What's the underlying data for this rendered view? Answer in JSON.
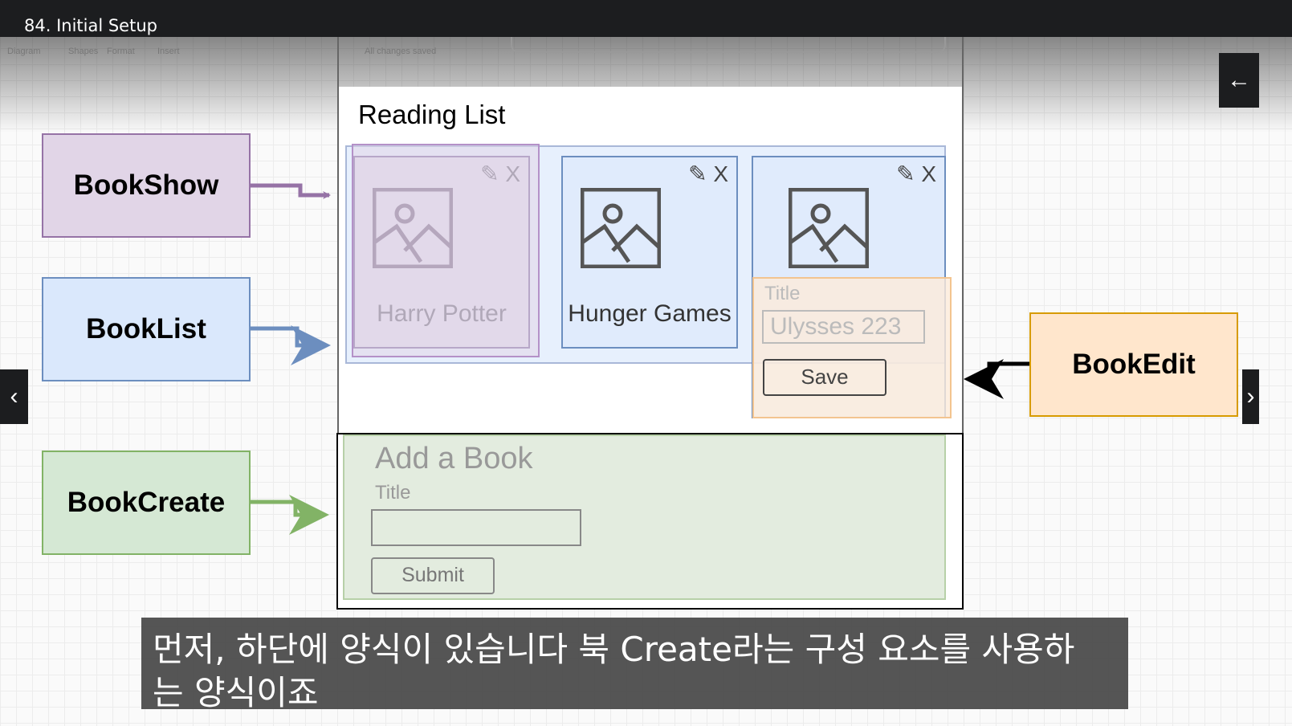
{
  "player": {
    "lecture_title": "84. Initial Setup",
    "back_icon": "arrow-left-icon",
    "prev_icon": "chevron-left-icon",
    "next_icon": "chevron-right-icon"
  },
  "editor_toolbar": {
    "items": [
      "Diagram",
      "Shapes",
      "Format",
      "Insert"
    ],
    "status": "All changes saved"
  },
  "mockup": {
    "heading": "Reading List",
    "books": [
      {
        "name": "Harry Potter",
        "edit_icon": "pencil-icon",
        "close": "X"
      },
      {
        "name": "Hunger Games",
        "edit_icon": "pencil-icon",
        "close": "X"
      },
      {
        "name": "",
        "edit_icon": "pencil-icon",
        "close": "X"
      }
    ],
    "edit_form": {
      "label": "Title",
      "value": "Ulysses 223",
      "save": "Save"
    },
    "create_form": {
      "heading": "Add a Book",
      "label": "Title",
      "value": "",
      "submit": "Submit"
    }
  },
  "components": {
    "show": "BookShow",
    "list": "BookList",
    "create": "BookCreate",
    "edit": "BookEdit"
  },
  "colors": {
    "show": "#9673a6",
    "list": "#6c8ebf",
    "create": "#82b366",
    "edit": "#d79b00"
  },
  "subtitle": {
    "line1": "먼저, 하단에 양식이 있습니다 북 Create라는 구성 요소를 사용하",
    "line2": "는 양식이죠"
  }
}
